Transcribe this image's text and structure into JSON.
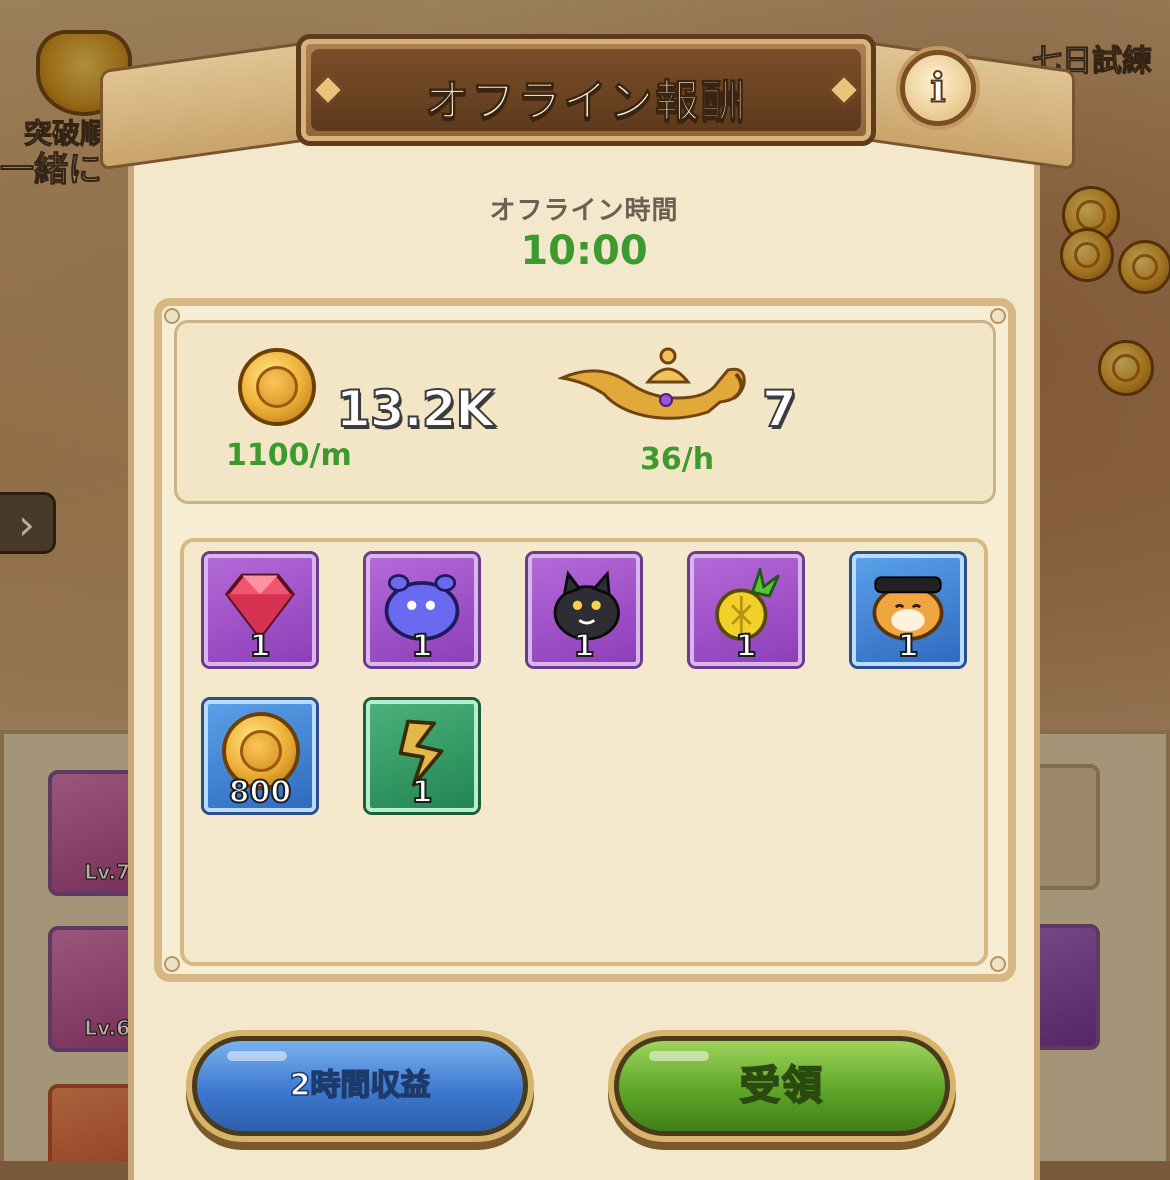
{
  "background": {
    "trophy_label": "突破順",
    "trophy_sub": "一緒に",
    "event_label": "七日試練",
    "lv_label_1": "Lv.7",
    "lv_label_2": "Lv.6"
  },
  "dialog": {
    "title": "オフライン報酬",
    "info_button": "i",
    "offline_time_label": "オフライン時間",
    "offline_time_value": "10:00"
  },
  "summary": {
    "gold_amount": "13.2K",
    "gold_rate": "1100/m",
    "lamp_amount": "7",
    "lamp_rate": "36/h"
  },
  "rewards": [
    {
      "icon": "ruby-gem-icon",
      "quantity": "1",
      "rarity": "purple"
    },
    {
      "icon": "blue-slime-icon",
      "quantity": "1",
      "rarity": "purple"
    },
    {
      "icon": "black-cat-icon",
      "quantity": "1",
      "rarity": "purple"
    },
    {
      "icon": "golden-pineapple-icon",
      "quantity": "1",
      "rarity": "purple"
    },
    {
      "icon": "shiba-dog-icon",
      "quantity": "1",
      "rarity": "blue"
    },
    {
      "icon": "gold-coin-icon",
      "quantity": "800",
      "rarity": "blue"
    },
    {
      "icon": "golden-branch-icon",
      "quantity": "1",
      "rarity": "green"
    }
  ],
  "buttons": {
    "double_label": "2時間収益",
    "claim_label": "受領"
  },
  "colors": {
    "accent_green": "#3d9a2e",
    "purple_rarity": "#8d3fb8",
    "blue_rarity": "#2f6bc0",
    "green_rarity": "#238652"
  }
}
